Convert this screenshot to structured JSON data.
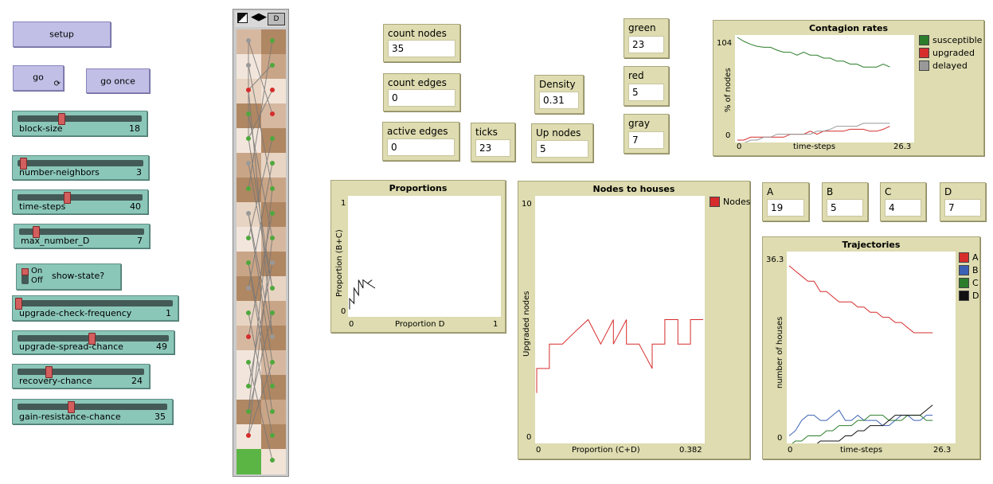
{
  "buttons": {
    "setup": "setup",
    "go": "go",
    "go_once": "go once"
  },
  "sliders": [
    {
      "label": "block-size",
      "value": "18",
      "fraction": 0.36
    },
    {
      "label": "number-neighbors",
      "value": "3",
      "fraction": 0.02
    },
    {
      "label": "time-steps",
      "value": "40",
      "fraction": 0.45
    },
    {
      "label": "max_number_D",
      "value": "7",
      "fraction": 0.1
    },
    {
      "label": "upgrade-check-frequency",
      "value": "1",
      "fraction": 0.0
    },
    {
      "label": "upgrade-spread-chance",
      "value": "49",
      "fraction": 0.49
    },
    {
      "label": "recovery-chance",
      "value": "24",
      "fraction": 0.24
    },
    {
      "label": "gain-resistance-chance",
      "value": "35",
      "fraction": 0.35
    }
  ],
  "switch": {
    "label": "show-state?",
    "on": "On",
    "off": "Off"
  },
  "view_toolbar": {
    "letter": "D"
  },
  "monitors": {
    "count_nodes": {
      "label": "count nodes",
      "value": "35"
    },
    "count_edges": {
      "label": "count edges",
      "value": "0"
    },
    "active_edges": {
      "label": "active edges",
      "value": "0"
    },
    "ticks": {
      "label": "ticks",
      "value": "23"
    },
    "density": {
      "label": "Density",
      "value": "0.31"
    },
    "up_nodes": {
      "label": "Up nodes",
      "value": "5"
    },
    "green": {
      "label": "green",
      "value": "23"
    },
    "red": {
      "label": "red",
      "value": "5"
    },
    "gray": {
      "label": "gray",
      "value": "7"
    },
    "A": {
      "label": "A",
      "value": "19"
    },
    "B": {
      "label": "B",
      "value": "5"
    },
    "C": {
      "label": "C",
      "value": "4"
    },
    "D": {
      "label": "D",
      "value": "7"
    }
  },
  "colors": {
    "button": "#c1bfe6",
    "slider": "#8bc7b9",
    "monitor": "#dedcb0",
    "green": "#2b7d2b",
    "red": "#d62c2c",
    "gray": "#999999",
    "blue": "#3c61b4",
    "black": "#111111"
  },
  "plots": {
    "contagion": {
      "title": "Contagion rates",
      "ylabel": "% of nodes",
      "xlabel": "time-steps",
      "ymax_label": "104",
      "ymin_label": "0",
      "xmin_label": "0",
      "xmax_label": "26.3",
      "legend": [
        {
          "name": "susceptible",
          "color": "#2b7d2b"
        },
        {
          "name": "upgraded",
          "color": "#d62c2c"
        },
        {
          "name": "delayed",
          "color": "#999999"
        }
      ]
    },
    "proportions": {
      "title": "Proportions",
      "ylabel": "Proportion (B+C)",
      "xlabel": "Proportion D",
      "ymax_label": "1",
      "ymin_label": "0",
      "xmin_label": "0",
      "xmax_label": "1"
    },
    "nodes_houses": {
      "title": "Nodes to houses",
      "ylabel": "Upgraded nodes",
      "xlabel": "Proportion (C+D)",
      "ymax_label": "10",
      "ymin_label": "0",
      "xmin_label": "0",
      "xmax_label": "0.382",
      "legend": [
        {
          "name": "Nodes",
          "color": "#d62c2c"
        }
      ]
    },
    "trajectories": {
      "title": "Trajectories",
      "ylabel": "number of houses",
      "xlabel": "time-steps",
      "ymax_label": "36.3",
      "ymin_label": "0",
      "xmin_label": "0",
      "xmax_label": "26.3",
      "legend": [
        {
          "name": "A",
          "color": "#d62c2c"
        },
        {
          "name": "B",
          "color": "#3c61b4"
        },
        {
          "name": "C",
          "color": "#2b7d2b"
        },
        {
          "name": "D",
          "color": "#111111"
        }
      ]
    }
  },
  "chart_data": [
    {
      "type": "line",
      "title": "Contagion rates",
      "xlabel": "time-steps",
      "ylabel": "% of nodes",
      "xlim": [
        0,
        26.3
      ],
      "ylim": [
        0,
        104
      ],
      "x": [
        0,
        1,
        2,
        3,
        4,
        5,
        6,
        7,
        8,
        9,
        10,
        11,
        12,
        13,
        14,
        15,
        16,
        17,
        18,
        19,
        20,
        21,
        22,
        23
      ],
      "series": [
        {
          "name": "susceptible",
          "color": "#2b7d2b",
          "values": [
            104,
            100,
            97,
            95,
            94,
            94,
            91,
            89,
            89,
            86,
            89,
            86,
            86,
            83,
            83,
            80,
            80,
            77,
            77,
            74,
            74,
            74,
            77,
            74
          ]
        },
        {
          "name": "upgraded",
          "color": "#d62c2c",
          "values": [
            0,
            0,
            3,
            3,
            3,
            3,
            3,
            3,
            6,
            6,
            6,
            9,
            6,
            9,
            9,
            9,
            9,
            11,
            11,
            11,
            9,
            9,
            11,
            14
          ]
        },
        {
          "name": "delayed",
          "color": "#999999",
          "values": [
            -3,
            -3,
            0,
            0,
            3,
            3,
            6,
            6,
            6,
            6,
            6,
            6,
            9,
            9,
            11,
            14,
            14,
            14,
            14,
            17,
            17,
            17,
            17,
            17
          ]
        }
      ]
    },
    {
      "type": "line",
      "title": "Proportions",
      "xlabel": "Proportion D",
      "ylabel": "Proportion (B+C)",
      "xlim": [
        0,
        1
      ],
      "ylim": [
        0,
        1
      ],
      "x": [
        0,
        0,
        0.03,
        0.03,
        0.06,
        0.06,
        0.09,
        0.09,
        0.12,
        0.15,
        0.12,
        0.17
      ],
      "series": [
        {
          "name": "",
          "color": "#111111",
          "values": [
            0.05,
            0.14,
            0.1,
            0.23,
            0.17,
            0.3,
            0.23,
            0.3,
            0.27,
            0.3,
            0.27,
            0.23
          ]
        }
      ]
    },
    {
      "type": "line",
      "title": "Nodes to houses",
      "xlabel": "Proportion (C+D)",
      "ylabel": "Upgraded nodes",
      "xlim": [
        0,
        0.382
      ],
      "ylim": [
        0,
        10
      ],
      "x": [
        0,
        0,
        0.029,
        0.029,
        0.059,
        0.088,
        0.118,
        0.147,
        0.176,
        0.176,
        0.206,
        0.206,
        0.235,
        0.265,
        0.265,
        0.294,
        0.294,
        0.324,
        0.324,
        0.353,
        0.353,
        0.382
      ],
      "series": [
        {
          "name": "Nodes",
          "color": "#d62c2c",
          "values": [
            2,
            3,
            3,
            4,
            4,
            4.5,
            5,
            4,
            5,
            4,
            5,
            4,
            4,
            3,
            4,
            4,
            5,
            5,
            4,
            4,
            5,
            5
          ]
        }
      ]
    },
    {
      "type": "line",
      "title": "Trajectories",
      "xlabel": "time-steps",
      "ylabel": "number of houses",
      "xlim": [
        0,
        26.3
      ],
      "ylim": [
        0,
        36.3
      ],
      "x": [
        0,
        1,
        2,
        3,
        4,
        5,
        6,
        7,
        8,
        9,
        10,
        11,
        12,
        13,
        14,
        15,
        16,
        17,
        18,
        19,
        20,
        21,
        22,
        23
      ],
      "series": [
        {
          "name": "A",
          "color": "#d62c2c",
          "values": [
            34,
            33,
            32,
            31,
            31,
            29,
            29,
            28,
            27,
            27,
            27,
            26,
            26,
            25,
            25,
            24,
            24,
            23,
            23,
            22,
            21,
            21,
            21,
            21
          ]
        },
        {
          "name": "B",
          "color": "#3c61b4",
          "values": [
            1,
            2,
            4,
            5,
            5,
            4,
            4,
            5,
            6,
            4,
            4,
            5,
            4,
            4,
            4,
            3,
            3,
            4,
            5,
            5,
            4,
            4,
            5,
            5
          ]
        },
        {
          "name": "C",
          "color": "#2b7d2b",
          "values": [
            -1,
            0,
            0,
            1,
            1,
            1,
            2,
            2,
            3,
            3,
            3,
            4,
            4,
            5,
            5,
            5,
            4,
            4,
            4,
            5,
            5,
            5,
            4,
            4
          ]
        },
        {
          "name": "D",
          "color": "#111111",
          "values": [
            -2,
            -2,
            -1,
            -1,
            -1,
            0,
            0,
            0,
            0,
            1,
            1,
            2,
            2,
            3,
            3,
            3,
            4,
            5,
            5,
            5,
            5,
            5,
            6,
            7
          ]
        }
      ]
    }
  ]
}
